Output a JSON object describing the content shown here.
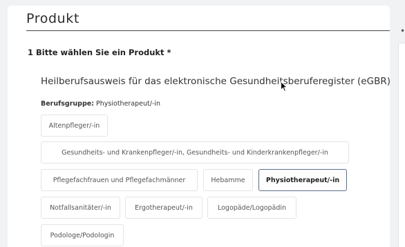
{
  "section": {
    "title": "Produkt"
  },
  "question": {
    "label": "1 Bitte wählen Sie ein Produkt *"
  },
  "product": {
    "name": "Heilberufsausweis für das elektronische Gesundheitsberuferegister (eGBR)"
  },
  "berufsgruppe": {
    "label": "Berufsgruppe:",
    "value": "Physiotherapeut/-in",
    "selected_index": 4,
    "options": [
      "Altenpfleger/-in",
      "Gesundheits- und Krankenpfleger/-in, Gesundheits- und Kinderkrankenpfleger/-in",
      "Pflegefachfrauen und Pflegefachmänner",
      "Hebamme",
      "Physiotherapeut/-in",
      "Notfallsanitäter/-in",
      "Ergotherapeut/-in",
      "Logopäde/Logopädin",
      "Podologe/Podologin"
    ]
  },
  "colors": {
    "background": "#f1f2f3",
    "card": "#ffffff",
    "chip_border": "#e2e4e7",
    "selected_border": "#5a6e86"
  },
  "icons": {
    "cursor": "mouse-pointer-icon"
  }
}
